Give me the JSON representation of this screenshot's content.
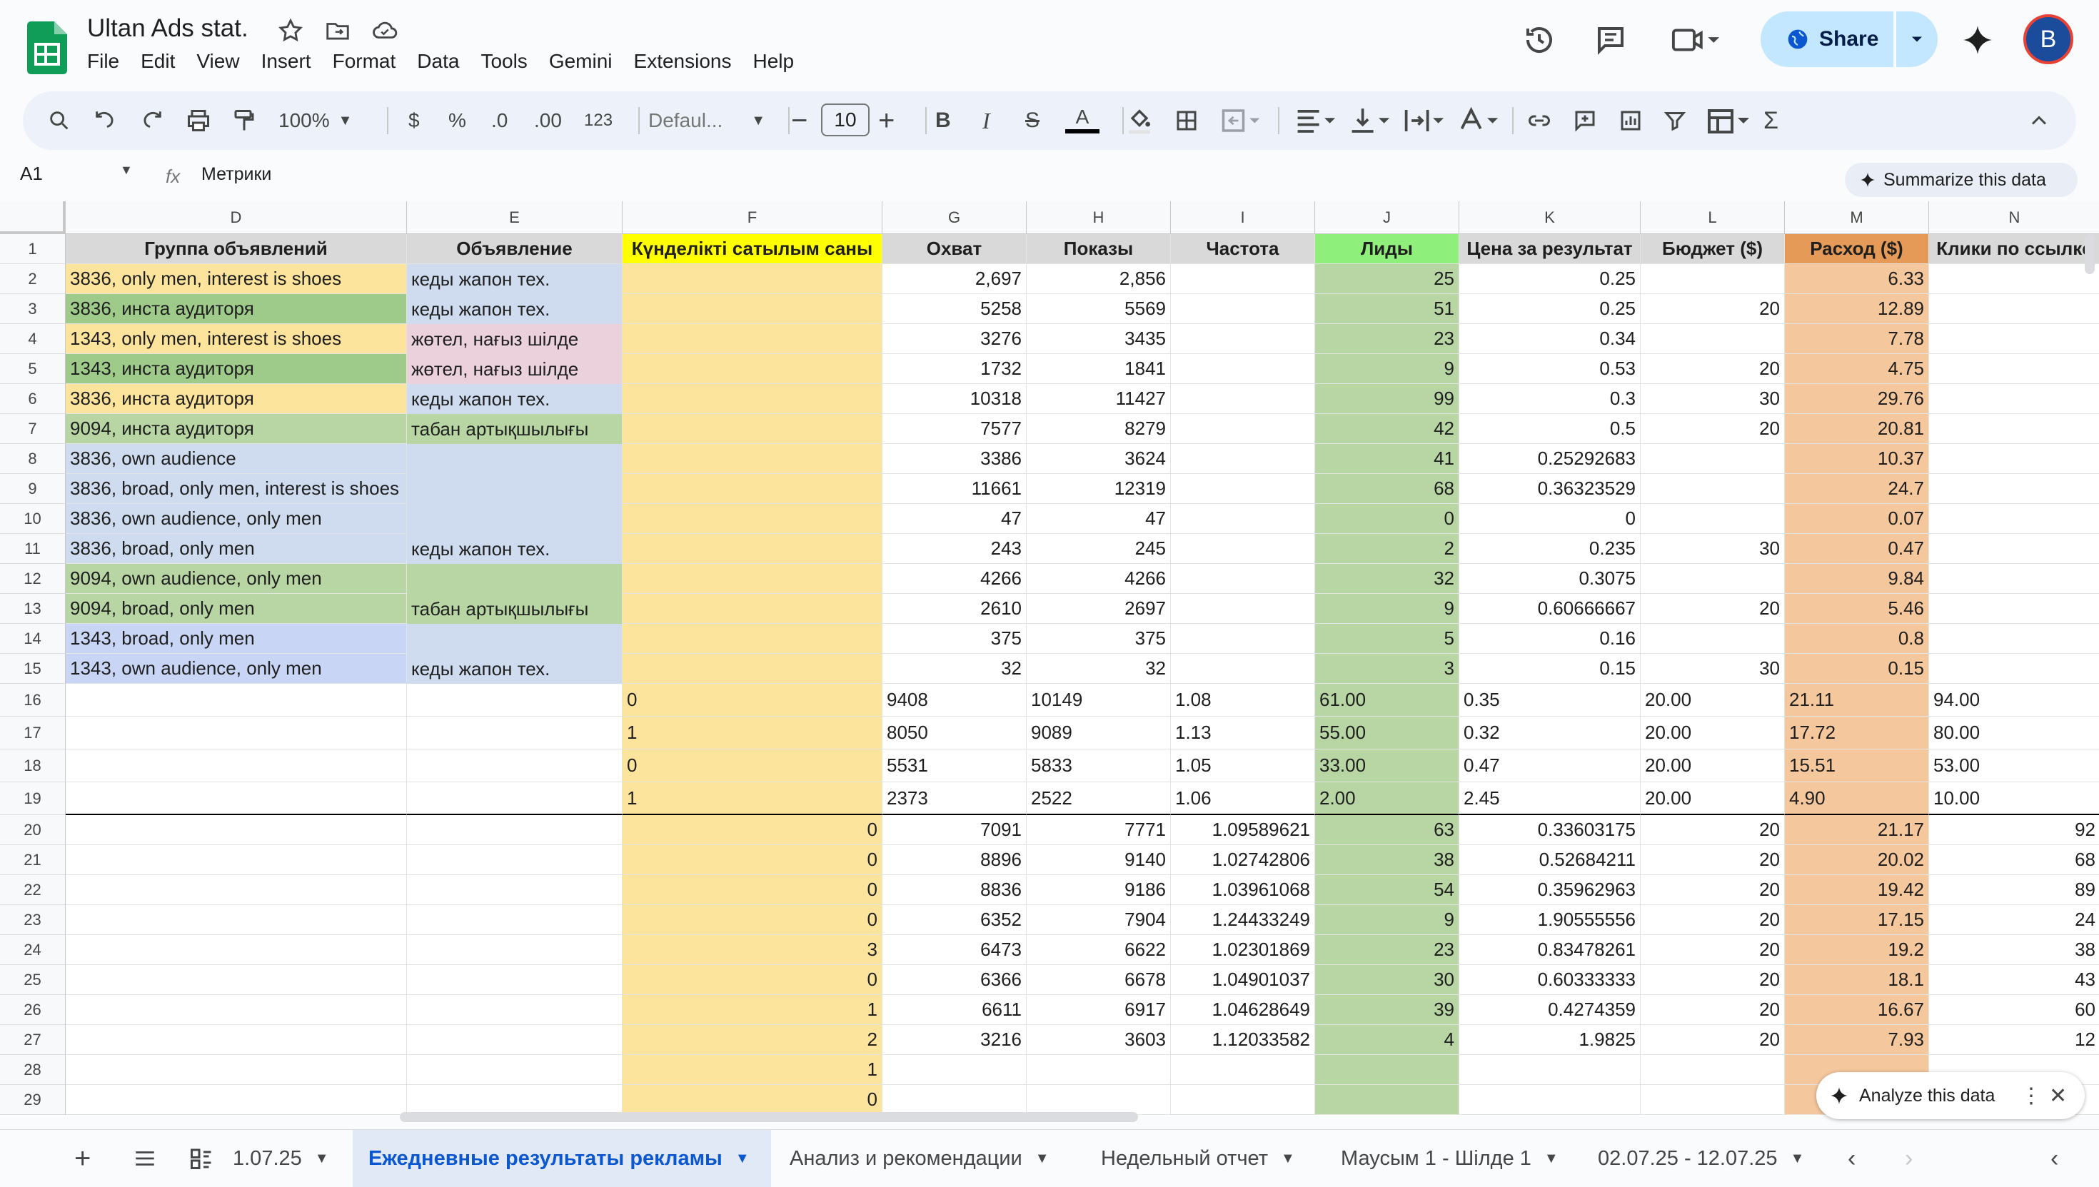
{
  "app": {
    "title": "Ultan Ads stat.",
    "share_label": "Share",
    "avatar_letter": "B",
    "brand_color": "#0f9d58"
  },
  "menu": [
    "File",
    "Edit",
    "View",
    "Insert",
    "Format",
    "Data",
    "Tools",
    "Gemini",
    "Extensions",
    "Help"
  ],
  "toolbar": {
    "zoom": "100%",
    "currency": "$",
    "percent": "%",
    "dec_down": ".0",
    "dec_up": ".00",
    "format_123": "123",
    "font": "Defaul...",
    "font_size": "10"
  },
  "formula_bar": {
    "cell_ref": "A1",
    "fx": "fx",
    "value": "Метрики",
    "summarize_label": "Summarize this data"
  },
  "columns": [
    {
      "letter": "D",
      "header": "Группа объявлений"
    },
    {
      "letter": "E",
      "header": "Объявление"
    },
    {
      "letter": "F",
      "header": "Күнделікті сатылым саны"
    },
    {
      "letter": "G",
      "header": "Охват"
    },
    {
      "letter": "H",
      "header": "Показы"
    },
    {
      "letter": "I",
      "header": "Частота"
    },
    {
      "letter": "J",
      "header": "Лиды"
    },
    {
      "letter": "K",
      "header": "Цена за результат"
    },
    {
      "letter": "L",
      "header": "Бюджет ($)"
    },
    {
      "letter": "M",
      "header": "Расход ($)"
    },
    {
      "letter": "N",
      "header": "Клики по ссылке"
    }
  ],
  "row_numbers": [
    "1",
    "2",
    "3",
    "4",
    "5",
    "6",
    "7",
    "8",
    "9",
    "10",
    "11",
    "12",
    "13",
    "14",
    "15",
    "16",
    "17",
    "18",
    "19",
    "20",
    "21",
    "22",
    "23",
    "24",
    "25",
    "26",
    "27",
    "28",
    "29"
  ],
  "rows": [
    {
      "D": "3836, only men, interest is shoes",
      "E": "кеды жапон тех.",
      "F": "",
      "G": "2,697",
      "H": "2,856",
      "I": "",
      "J": "25",
      "K": "0.25",
      "L": "",
      "M": "6.33",
      "N": ""
    },
    {
      "D": "3836, инста аудиторя",
      "E": "кеды жапон тех.",
      "F": "",
      "G": "5258",
      "H": "5569",
      "I": "",
      "J": "51",
      "K": "0.25",
      "L": "20",
      "M": "12.89",
      "N": ""
    },
    {
      "D": "1343, only men, interest is shoes",
      "E": "жөтел, нағыз шілде",
      "F": "",
      "G": "3276",
      "H": "3435",
      "I": "",
      "J": "23",
      "K": "0.34",
      "L": "",
      "M": "7.78",
      "N": ""
    },
    {
      "D": "1343, инста аудиторя",
      "E": "жөтел, нағыз шілде",
      "F": "",
      "G": "1732",
      "H": "1841",
      "I": "",
      "J": "9",
      "K": "0.53",
      "L": "20",
      "M": "4.75",
      "N": ""
    },
    {
      "D": "3836, инста аудиторя",
      "E": "кеды жапон тех.",
      "F": "",
      "G": "10318",
      "H": "11427",
      "I": "",
      "J": "99",
      "K": "0.3",
      "L": "30",
      "M": "29.76",
      "N": ""
    },
    {
      "D": "9094, инста аудиторя",
      "E": "табан артықшылығы",
      "F": "",
      "G": "7577",
      "H": "8279",
      "I": "",
      "J": "42",
      "K": "0.5",
      "L": "20",
      "M": "20.81",
      "N": ""
    },
    {
      "D": "3836, own audience",
      "E": "",
      "F": "",
      "G": "3386",
      "H": "3624",
      "I": "",
      "J": "41",
      "K": "0.25292683",
      "L": "",
      "M": "10.37",
      "N": ""
    },
    {
      "D": "3836, broad, only men, interest is shoes",
      "E": "",
      "F": "",
      "G": "11661",
      "H": "12319",
      "I": "",
      "J": "68",
      "K": "0.36323529",
      "L": "",
      "M": "24.7",
      "N": ""
    },
    {
      "D": "3836, own audience, only men",
      "E": "",
      "F": "",
      "G": "47",
      "H": "47",
      "I": "",
      "J": "0",
      "K": "0",
      "L": "",
      "M": "0.07",
      "N": ""
    },
    {
      "D": "3836, broad, only men",
      "E": "кеды жапон тех.",
      "F": "",
      "G": "243",
      "H": "245",
      "I": "",
      "J": "2",
      "K": "0.235",
      "L": "30",
      "M": "0.47",
      "N": ""
    },
    {
      "D": "9094, own audience, only men",
      "E": "",
      "F": "",
      "G": "4266",
      "H": "4266",
      "I": "",
      "J": "32",
      "K": "0.3075",
      "L": "",
      "M": "9.84",
      "N": ""
    },
    {
      "D": "9094, broad, only men",
      "E": "табан артықшылығы",
      "F": "",
      "G": "2610",
      "H": "2697",
      "I": "",
      "J": "9",
      "K": "0.60666667",
      "L": "20",
      "M": "5.46",
      "N": ""
    },
    {
      "D": "1343, broad, only men",
      "E": "",
      "F": "",
      "G": "375",
      "H": "375",
      "I": "",
      "J": "5",
      "K": "0.16",
      "L": "",
      "M": "0.8",
      "N": ""
    },
    {
      "D": "1343, own audience, only men",
      "E": "кеды жапон тех.",
      "F": "",
      "G": "32",
      "H": "32",
      "I": "",
      "J": "3",
      "K": "0.15",
      "L": "30",
      "M": "0.15",
      "N": ""
    },
    {
      "D": "",
      "E": "",
      "F": "0",
      "G": "9408",
      "H": "10149",
      "I": "1.08",
      "J": "61.00",
      "K": "0.35",
      "L": "20.00",
      "M": "21.11",
      "N": "94.00"
    },
    {
      "D": "",
      "E": "",
      "F": "1",
      "G": "8050",
      "H": "9089",
      "I": "1.13",
      "J": "55.00",
      "K": "0.32",
      "L": "20.00",
      "M": "17.72",
      "N": "80.00"
    },
    {
      "D": "",
      "E": "",
      "F": "0",
      "G": "5531",
      "H": "5833",
      "I": "1.05",
      "J": "33.00",
      "K": "0.47",
      "L": "20.00",
      "M": "15.51",
      "N": "53.00"
    },
    {
      "D": "",
      "E": "",
      "F": "1",
      "G": "2373",
      "H": "2522",
      "I": "1.06",
      "J": "2.00",
      "K": "2.45",
      "L": "20.00",
      "M": "4.90",
      "N": "10.00"
    },
    {
      "D": "",
      "E": "",
      "F": "0",
      "G": "7091",
      "H": "7771",
      "I": "1.09589621",
      "J": "63",
      "K": "0.33603175",
      "L": "20",
      "M": "21.17",
      "N": "92"
    },
    {
      "D": "",
      "E": "",
      "F": "0",
      "G": "8896",
      "H": "9140",
      "I": "1.02742806",
      "J": "38",
      "K": "0.52684211",
      "L": "20",
      "M": "20.02",
      "N": "68"
    },
    {
      "D": "",
      "E": "",
      "F": "0",
      "G": "8836",
      "H": "9186",
      "I": "1.03961068",
      "J": "54",
      "K": "0.35962963",
      "L": "20",
      "M": "19.42",
      "N": "89"
    },
    {
      "D": "",
      "E": "",
      "F": "0",
      "G": "6352",
      "H": "7904",
      "I": "1.24433249",
      "J": "9",
      "K": "1.90555556",
      "L": "20",
      "M": "17.15",
      "N": "24"
    },
    {
      "D": "",
      "E": "",
      "F": "3",
      "G": "6473",
      "H": "6622",
      "I": "1.02301869",
      "J": "23",
      "K": "0.83478261",
      "L": "20",
      "M": "19.2",
      "N": "38"
    },
    {
      "D": "",
      "E": "",
      "F": "0",
      "G": "6366",
      "H": "6678",
      "I": "1.04901037",
      "J": "30",
      "K": "0.60333333",
      "L": "20",
      "M": "18.1",
      "N": "43"
    },
    {
      "D": "",
      "E": "",
      "F": "1",
      "G": "6611",
      "H": "6917",
      "I": "1.04628649",
      "J": "39",
      "K": "0.4274359",
      "L": "20",
      "M": "16.67",
      "N": "60"
    },
    {
      "D": "",
      "E": "",
      "F": "2",
      "G": "3216",
      "H": "3603",
      "I": "1.12033582",
      "J": "4",
      "K": "1.9825",
      "L": "20",
      "M": "7.93",
      "N": "12"
    },
    {
      "D": "",
      "E": "",
      "F": "1",
      "G": "",
      "H": "",
      "I": "",
      "J": "",
      "K": "",
      "L": "",
      "M": "",
      "N": ""
    },
    {
      "D": "",
      "E": "",
      "F": "0",
      "G": "",
      "H": "",
      "I": "",
      "J": "",
      "K": "",
      "L": "",
      "M": "",
      "N": ""
    }
  ],
  "colors": {
    "yellow_header": "#ffff00",
    "green_header": "#8ef07a",
    "orange_header": "#e69a57",
    "cream": "#fde49c",
    "green_light": "#b7d6a4",
    "green_mid": "#9fcb8a",
    "blue_light": "#cfdcef",
    "blue_mid": "#c8d5f4",
    "pink_light": "#ead1dc",
    "orange_light": "#f5c79d",
    "header_grey": "#d9d9d9"
  },
  "tabs": [
    "1.07.25",
    "Ежедневные результаты рекламы",
    "Анализ и рекомендации",
    "Недельный отчет",
    "Маусым 1 - Шілде 1",
    "02.07.25 - 12.07.25"
  ],
  "active_tab": "Ежедневные результаты рекламы",
  "analyze_label": "Analyze this data"
}
